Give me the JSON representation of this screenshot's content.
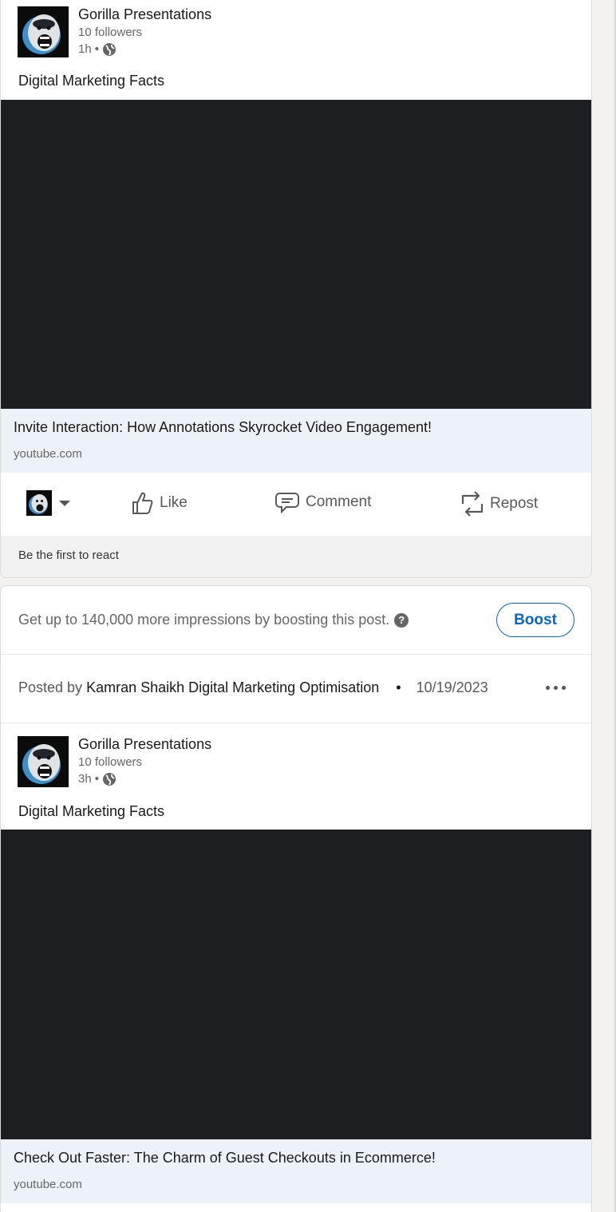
{
  "post1": {
    "author": "Gorilla Presentations",
    "followers": "10 followers",
    "time": "1h",
    "separator": "•",
    "text": "Digital Marketing Facts",
    "link_title": "Invite Interaction: How Annotations Skyrocket Video Engagement!",
    "link_domain": "youtube.com",
    "actions": {
      "like": "Like",
      "comment": "Comment",
      "repost": "Repost"
    },
    "react_prompt": "Be the first to react"
  },
  "post2": {
    "boost_text": "Get up to 140,000 more impressions by boosting this post.",
    "boost_button": "Boost",
    "posted_by_label": "Posted by",
    "poster": "Kamran Shaikh Digital Marketing Optimisation",
    "bullet": "•",
    "date": "10/19/2023",
    "author": "Gorilla Presentations",
    "followers": "10 followers",
    "time": "3h",
    "separator": "•",
    "text": "Digital Marketing Facts",
    "link_title": "Check Out Faster: The Charm of Guest Checkouts in Ecommerce!",
    "link_domain": "youtube.com"
  },
  "colors": {
    "accent": "#0a66c2",
    "video_bg": "#1c1e21",
    "link_box_bg": "#edf2f9",
    "muted_text": "#666666"
  },
  "icons": [
    "gorilla-logo",
    "globe-icon",
    "like-icon",
    "comment-icon",
    "repost-icon",
    "help-icon",
    "more-icon",
    "chevron-down-icon"
  ]
}
